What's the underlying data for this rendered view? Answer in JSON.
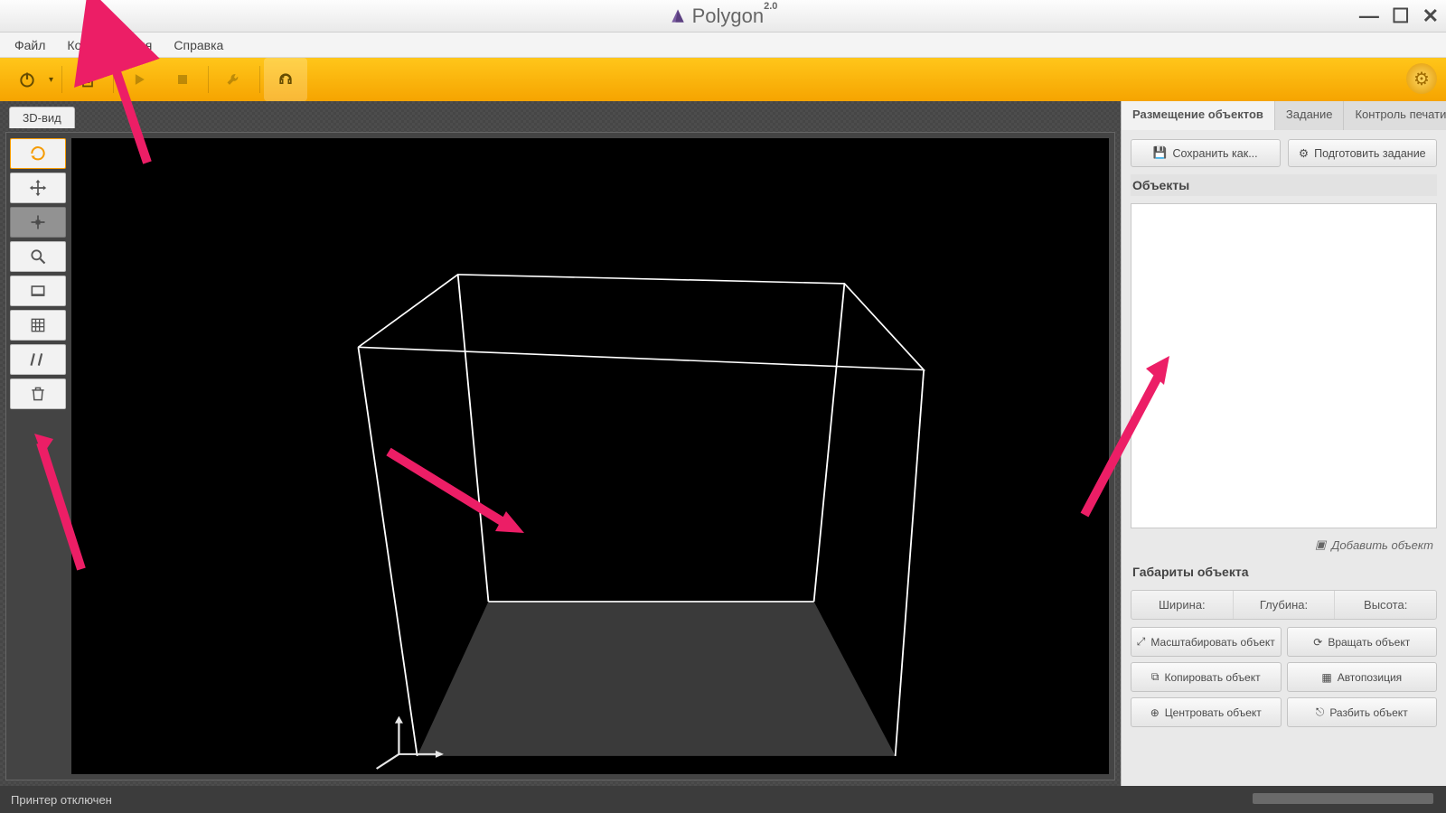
{
  "app": {
    "name": "Polygon",
    "version": "2.0"
  },
  "menubar": {
    "file": "Файл",
    "config": "Конфигурация",
    "help": "Справка"
  },
  "toolbar": {
    "power": "power",
    "file": "file",
    "play": "play",
    "stop": "stop",
    "wrench": "wrench",
    "support": "support",
    "settings": "settings"
  },
  "view": {
    "tab": "3D-вид"
  },
  "side_tools": {
    "rotate": "rotate",
    "move": "move",
    "move2": "move-disabled",
    "zoom": "zoom",
    "perspective": "perspective",
    "grid": "grid",
    "parallel": "parallel",
    "delete": "delete"
  },
  "right": {
    "tabs": {
      "placement": "Размещение объектов",
      "task": "Задание",
      "printctl": "Контроль печати"
    },
    "save_as": "Сохранить как...",
    "prepare": "Подготовить задание",
    "objects_header": "Объекты",
    "add_object": "Добавить объект",
    "dims_header": "Габариты объекта",
    "dims": {
      "w": "Ширина:",
      "d": "Глубина:",
      "h": "Высота:"
    },
    "actions": {
      "scale": "Масштабировать объект",
      "rotate": "Вращать объект",
      "copy": "Копировать объект",
      "autopos": "Автопозиция",
      "center": "Центровать объект",
      "split": "Разбить объект"
    }
  },
  "status": {
    "text": "Принтер отключен"
  }
}
